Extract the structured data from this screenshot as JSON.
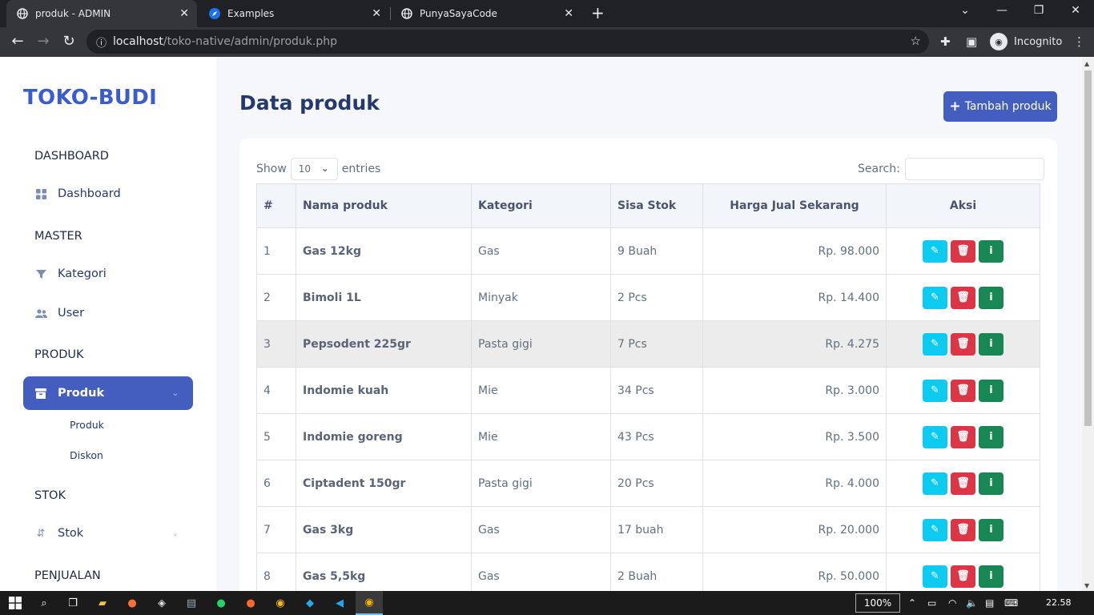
{
  "browser": {
    "tabs": [
      {
        "title": "produk - ADMIN",
        "active": true
      },
      {
        "title": "Examples",
        "active": false
      },
      {
        "title": "PunyaSayaCode",
        "active": false
      }
    ],
    "url_host": "localhost",
    "url_path": "/toko-native/admin/produk.php",
    "profile_label": "Incognito"
  },
  "sidebar": {
    "brand": "TOKO-BUDI",
    "sections": {
      "dashboard": "DASHBOARD",
      "master": "MASTER",
      "produk": "PRODUK",
      "stok": "STOK",
      "penjualan": "PENJUALAN"
    },
    "items": {
      "dashboard": "Dashboard",
      "kategori": "Kategori",
      "user": "User",
      "produk": "Produk",
      "stok": "Stok"
    },
    "subitems": {
      "produk": "Produk",
      "diskon": "Diskon"
    }
  },
  "page": {
    "title": "Data produk",
    "add_button": "Tambah produk"
  },
  "datatable": {
    "show_label": "Show",
    "entries_value": "10",
    "entries_label": "entries",
    "search_label": "Search:",
    "search_value": "",
    "headers": [
      "#",
      "Nama produk",
      "Kategori",
      "Sisa Stok",
      "Harga Jual Sekarang",
      "Aksi"
    ],
    "rows": [
      {
        "no": "1",
        "name": "Gas 12kg",
        "category": "Gas",
        "stock": "9 Buah",
        "price": "Rp. 98.000"
      },
      {
        "no": "2",
        "name": "Bimoli 1L",
        "category": "Minyak",
        "stock": "2 Pcs",
        "price": "Rp. 14.400"
      },
      {
        "no": "3",
        "name": "Pepsodent 225gr",
        "category": "Pasta gigi",
        "stock": "7 Pcs",
        "price": "Rp. 4.275"
      },
      {
        "no": "4",
        "name": "Indomie kuah",
        "category": "Mie",
        "stock": "34 Pcs",
        "price": "Rp. 3.000"
      },
      {
        "no": "5",
        "name": "Indomie goreng",
        "category": "Mie",
        "stock": "43 Pcs",
        "price": "Rp. 3.500"
      },
      {
        "no": "6",
        "name": "Ciptadent 150gr",
        "category": "Pasta gigi",
        "stock": "20 Pcs",
        "price": "Rp. 4.000"
      },
      {
        "no": "7",
        "name": "Gas 3kg",
        "category": "Gas",
        "stock": "17 buah",
        "price": "Rp. 20.000"
      },
      {
        "no": "8",
        "name": "Gas 5,5kg",
        "category": "Gas",
        "stock": "2 Buah",
        "price": "Rp. 50.000"
      }
    ]
  },
  "taskbar": {
    "zoom": "100%",
    "time": "22.58"
  },
  "colors": {
    "primary": "#435ebe",
    "edit": "#0dcaf0",
    "delete": "#dc3545",
    "info": "#198754"
  }
}
